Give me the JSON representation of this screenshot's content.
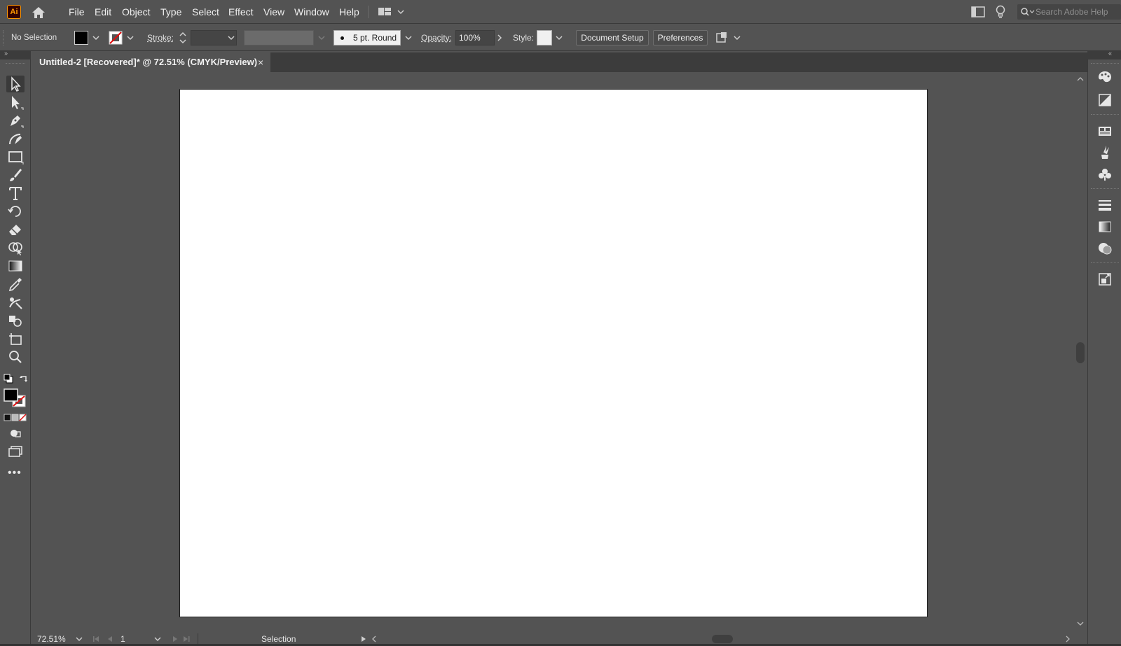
{
  "app": {
    "logo_text": "Ai"
  },
  "menu": {
    "items": [
      "File",
      "Edit",
      "Object",
      "Type",
      "Select",
      "Effect",
      "View",
      "Window",
      "Help"
    ]
  },
  "search": {
    "placeholder": "Search Adobe Help"
  },
  "control_bar": {
    "selection_status": "No Selection",
    "stroke_label": "Stroke:",
    "stroke_weight": "",
    "brush_label": "5 pt. Round",
    "opacity_label": "Opacity:",
    "opacity_value": "100%",
    "style_label": "Style:",
    "document_setup_label": "Document Setup",
    "preferences_label": "Preferences",
    "fill_color": "#000000",
    "stroke_color": "none"
  },
  "document": {
    "tab_title": "Untitled-2 [Recovered]* @ 72.51% (CMYK/Preview)",
    "close_glyph": "×"
  },
  "tools": [
    {
      "name": "selection-tool",
      "active": true
    },
    {
      "name": "direct-selection-tool"
    },
    {
      "name": "pen-tool"
    },
    {
      "name": "curvature-tool"
    },
    {
      "name": "rectangle-tool"
    },
    {
      "name": "paintbrush-tool"
    },
    {
      "name": "type-tool"
    },
    {
      "name": "rotate-tool"
    },
    {
      "name": "eraser-tool"
    },
    {
      "name": "shape-builder-tool"
    },
    {
      "name": "gradient-tool"
    },
    {
      "name": "eyedropper-tool"
    },
    {
      "name": "puppet-warp-tool"
    },
    {
      "name": "shape-tool"
    },
    {
      "name": "artboard-tool"
    },
    {
      "name": "zoom-tool"
    }
  ],
  "status_bar": {
    "zoom": "72.51%",
    "artboard_number": "1",
    "current_tool": "Selection"
  },
  "colors": {
    "ui_bg": "#535353",
    "panel_dark": "#3c3c3c",
    "artboard": "#ffffff",
    "accent_orange": "#ff9a00"
  }
}
